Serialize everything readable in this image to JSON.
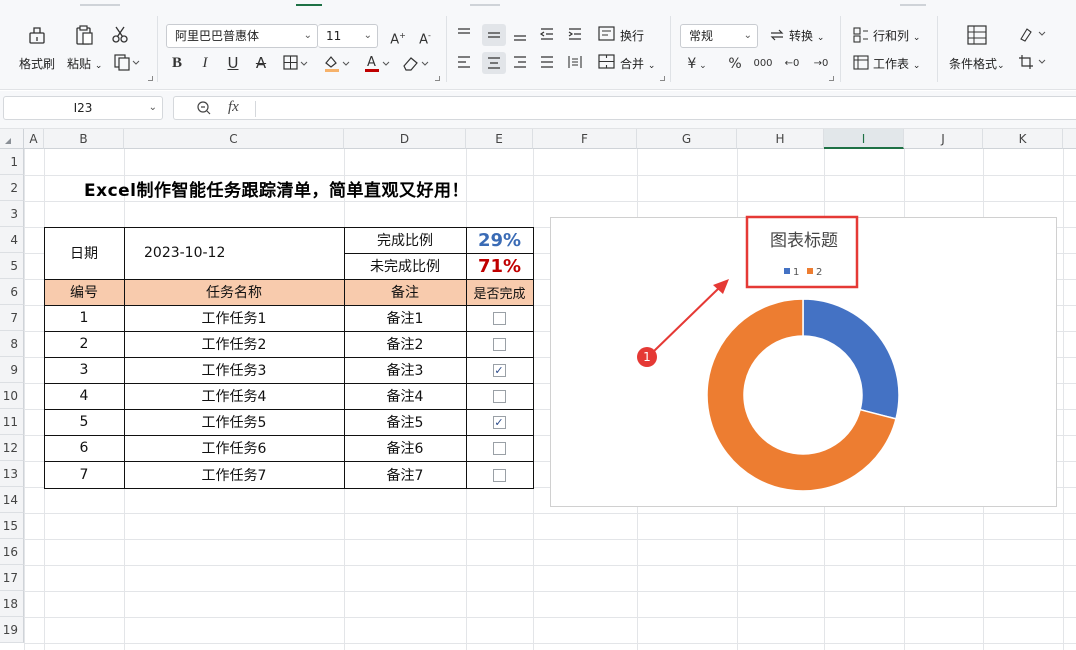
{
  "ribbon": {
    "format_painter": "格式刷",
    "paste": "粘贴",
    "font_name": "阿里巴巴普惠体",
    "font_size": "11",
    "wrap": "换行",
    "merge": "合并",
    "number_format": "常规",
    "convert": "转换",
    "row_col": "行和列",
    "worksheet": "工作表",
    "cond_format": "条件格式",
    "increase_font": "A⁺",
    "decrease_font": "A⁻",
    "bold": "B",
    "italic": "I",
    "underline": "U",
    "strike": "A",
    "currency": "¥",
    "percent": "%",
    "thousands": "000",
    "inc_decimal": "←0",
    "dec_decimal": "→0"
  },
  "formula_bar": {
    "cell_ref": "I23",
    "fx": "fx",
    "formula": ""
  },
  "columns": [
    "A",
    "B",
    "C",
    "D",
    "E",
    "F",
    "G",
    "H",
    "I",
    "J",
    "K"
  ],
  "rows": [
    "1",
    "2",
    "3",
    "4",
    "5",
    "6",
    "7",
    "8",
    "9",
    "10",
    "11",
    "12",
    "13",
    "14",
    "15",
    "16",
    "17",
    "18",
    "19"
  ],
  "sheet": {
    "title": "Excel制作智能任务跟踪清单，简单直观又好用！",
    "date_label": "日期",
    "date_value": "2023-10-12",
    "done_label": "完成比例",
    "done_value": "29%",
    "undone_label": "未完成比例",
    "undone_value": "71%",
    "headers": [
      "编号",
      "任务名称",
      "备注",
      "是否完成"
    ],
    "tasks": [
      {
        "id": "1",
        "name": "工作任务1",
        "note": "备注1",
        "done": false
      },
      {
        "id": "2",
        "name": "工作任务2",
        "note": "备注2",
        "done": false
      },
      {
        "id": "3",
        "name": "工作任务3",
        "note": "备注3",
        "done": true
      },
      {
        "id": "4",
        "name": "工作任务4",
        "note": "备注4",
        "done": false
      },
      {
        "id": "5",
        "name": "工作任务5",
        "note": "备注5",
        "done": true
      },
      {
        "id": "6",
        "name": "工作任务6",
        "note": "备注6",
        "done": false
      },
      {
        "id": "7",
        "name": "工作任务7",
        "note": "备注7",
        "done": false
      }
    ],
    "colors": {
      "done": "#3a6bb5",
      "undone": "#c00000",
      "header_fill": "#f8cbad"
    }
  },
  "chart_data": {
    "type": "pie",
    "variant": "doughnut",
    "title": "图表标题",
    "categories": [
      "1",
      "2"
    ],
    "values": [
      0.29,
      0.71
    ],
    "colors": [
      "#4472c4",
      "#ed7d31"
    ],
    "legend": "top"
  },
  "annotation": {
    "badge": "1",
    "highlight_color": "#e53935"
  }
}
